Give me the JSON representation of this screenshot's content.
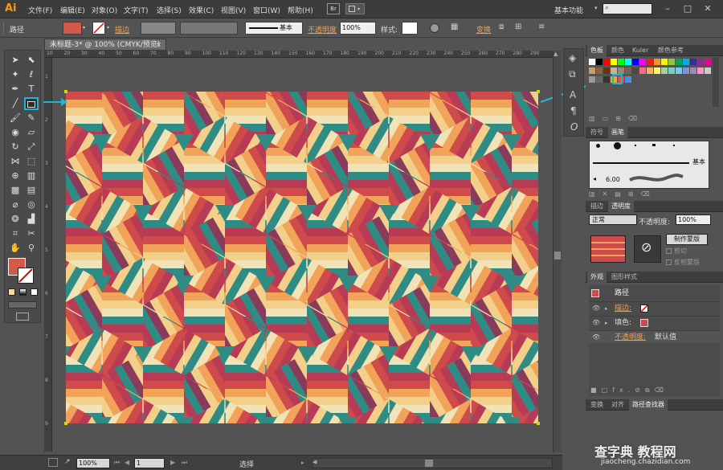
{
  "app": {
    "logo": "Ai"
  },
  "menus": [
    "文件(F)",
    "编辑(E)",
    "对象(O)",
    "文字(T)",
    "选择(S)",
    "效果(C)",
    "视图(V)",
    "窗口(W)",
    "帮助(H)"
  ],
  "bridge_btn": "Br",
  "workspace": "基本功能",
  "search": {
    "placeholder": ""
  },
  "control": {
    "object_type": "路径",
    "stroke_label": "描边",
    "brush_label": "基本",
    "opacity_label": "不透明度",
    "opacity_value": "100%",
    "style_label": "样式:",
    "transform_label": "变换"
  },
  "doc_tab": "未标题-3* @ 100% (CMYK/预览)",
  "ruler_h": [
    "10",
    "20",
    "30",
    "40",
    "50",
    "60",
    "70",
    "80",
    "90",
    "100",
    "110",
    "120",
    "130",
    "140",
    "150",
    "160",
    "170",
    "180",
    "190",
    "200",
    "210",
    "220",
    "230",
    "240",
    "250",
    "260",
    "270",
    "280",
    "290"
  ],
  "ruler_v": [
    "1",
    "2",
    "3",
    "4",
    "5",
    "6",
    "7",
    "8",
    "9"
  ],
  "swatches_panel": {
    "tabs": [
      "色板",
      "颜色",
      "Kuler",
      "颜色参考"
    ],
    "colors": [
      "#ffffff",
      "#000000",
      "#ff0000",
      "#ffff00",
      "#00ff00",
      "#00ffff",
      "#0000ff",
      "#ff00ff",
      "#ed1c24",
      "#f7941d",
      "#fff200",
      "#8dc63f",
      "#00a651",
      "#00aeef",
      "#2e3192",
      "#92278f",
      "#ec008c",
      "#c69c6d",
      "#8c6239",
      "#603913",
      "#c7b299",
      "#998675",
      "#736357",
      "#534741",
      "#f26d7d",
      "#fbaf5d",
      "#fff568",
      "#a3d39c",
      "#7accc8",
      "#6dcff6",
      "#8393ca",
      "#a186be",
      "#f49ac1",
      "#cccccc",
      "#999999",
      "#666666",
      "#333333",
      "#f5a623",
      "#e94e3c",
      "#4a90e2"
    ]
  },
  "brushes_panel": {
    "tabs": [
      "符号",
      "画笔"
    ],
    "basic_label": "基本",
    "size_value": "6.00"
  },
  "transparency_panel": {
    "tabs": [
      "描边",
      "透明度"
    ],
    "blend_mode": "正常",
    "opacity_label": "不透明度:",
    "opacity_value": "100%",
    "make_mask_btn": "制作蒙版",
    "clip_label": "剪切",
    "invert_label": "反相蒙版"
  },
  "appearance_panel": {
    "tabs": [
      "外观",
      "图形样式"
    ],
    "object_label": "路径",
    "rows": [
      {
        "label": "描边:",
        "orange": true
      },
      {
        "label": "填色:",
        "orange": false
      },
      {
        "label": "不透明度:",
        "value": "默认值",
        "orange": true
      }
    ],
    "fx_label": "fx."
  },
  "bottom_tabs": [
    "变换",
    "对齐",
    "路径查找器"
  ],
  "statusbar": {
    "zoom": "100%",
    "page": "1",
    "tool": "选择"
  },
  "watermark": {
    "line1": "查字典 教程网",
    "line2": "jiaocheng.chazidian.com"
  },
  "palette": {
    "red": "#cf4a4a",
    "crimson": "#b83b55",
    "orange": "#f2a35a",
    "yellow": "#f3d08a",
    "cream": "#f2e3b6",
    "teal": "#2e8c85",
    "plum": "#8a3a5a",
    "callout": "#1fb6d1",
    "ui_orange": "#f5a04a"
  }
}
